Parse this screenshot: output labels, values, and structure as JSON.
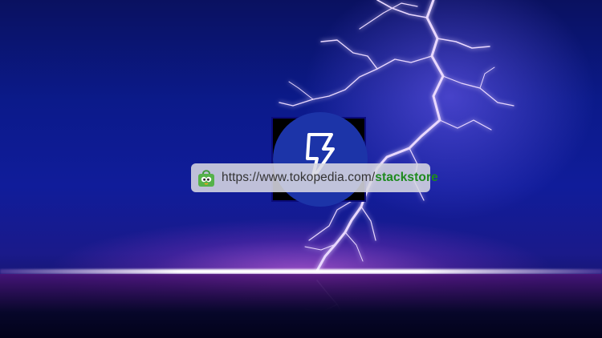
{
  "scene": {
    "description_icon": "lightning-bolt-icon",
    "colors": {
      "sky": "#0b1a8a",
      "glow": "#ff78ff",
      "logo_circle": "#1c34a8",
      "url_path": "#1d8a1d"
    }
  },
  "logo": {
    "icon": "lightning-bolt-icon"
  },
  "url_bar": {
    "icon": "tokopedia-bag-icon",
    "base": "https://www.tokopedia.com/",
    "path": "stackstore"
  }
}
